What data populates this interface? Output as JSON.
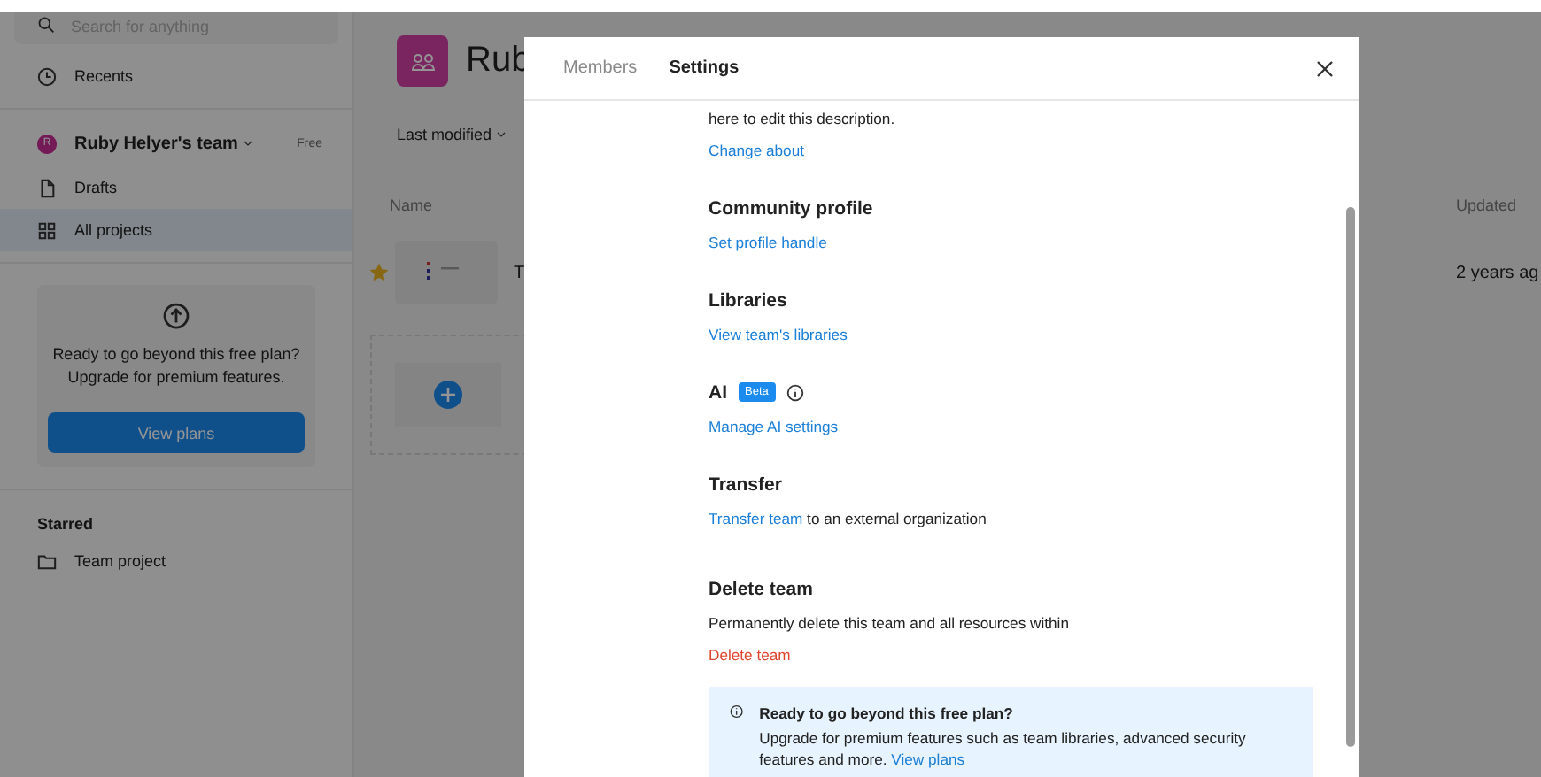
{
  "sidebar": {
    "search": {
      "placeholder": "Search for anything"
    },
    "recents": {
      "label": "Recents"
    },
    "team": {
      "initial": "R",
      "name": "Ruby Helyer's team",
      "plan": "Free"
    },
    "items": [
      {
        "kind": "file",
        "label": "Drafts",
        "selected": false
      },
      {
        "kind": "grid",
        "label": "All projects",
        "selected": true
      }
    ],
    "upgrade": {
      "text": "Ready to go beyond this free plan? Upgrade for premium features.",
      "button": "View plans"
    },
    "starred": {
      "heading": "Starred",
      "items": [
        {
          "label": "Team project"
        }
      ]
    }
  },
  "main": {
    "title": "Rub",
    "sort": "Last modified",
    "columns": {
      "name": "Name",
      "updated": "Updated"
    },
    "rows": [
      {
        "kind": "file",
        "starred": true,
        "name": "T",
        "updated": "2 years ag"
      },
      {
        "kind": "new"
      }
    ]
  },
  "modal": {
    "tabs": [
      {
        "label": "Members",
        "selected": false
      },
      {
        "label": "Settings",
        "selected": true
      }
    ],
    "sections": [
      {
        "text": "here to edit this description.",
        "link": "Change about",
        "kind": "block"
      },
      {
        "heading": "Community profile",
        "link": "Set profile handle",
        "kind": "block"
      },
      {
        "heading": "Libraries",
        "link": "View team's libraries",
        "kind": "block"
      },
      {
        "heading": "AI",
        "badge": "Beta",
        "info": true,
        "link": "Manage AI settings",
        "kind": "block"
      },
      {
        "heading": "Transfer",
        "link": "Transfer team",
        "text": " to an external organization",
        "kind": "inline"
      },
      {
        "heading": "Delete team",
        "text": "Permanently delete this team and all resources within",
        "link": "Delete team",
        "kind": "danger"
      }
    ],
    "banner": {
      "title": "Ready to go beyond this free plan?",
      "text": "Upgrade for premium features such as team libraries, advanced security features and more. ",
      "link": "View plans"
    }
  }
}
